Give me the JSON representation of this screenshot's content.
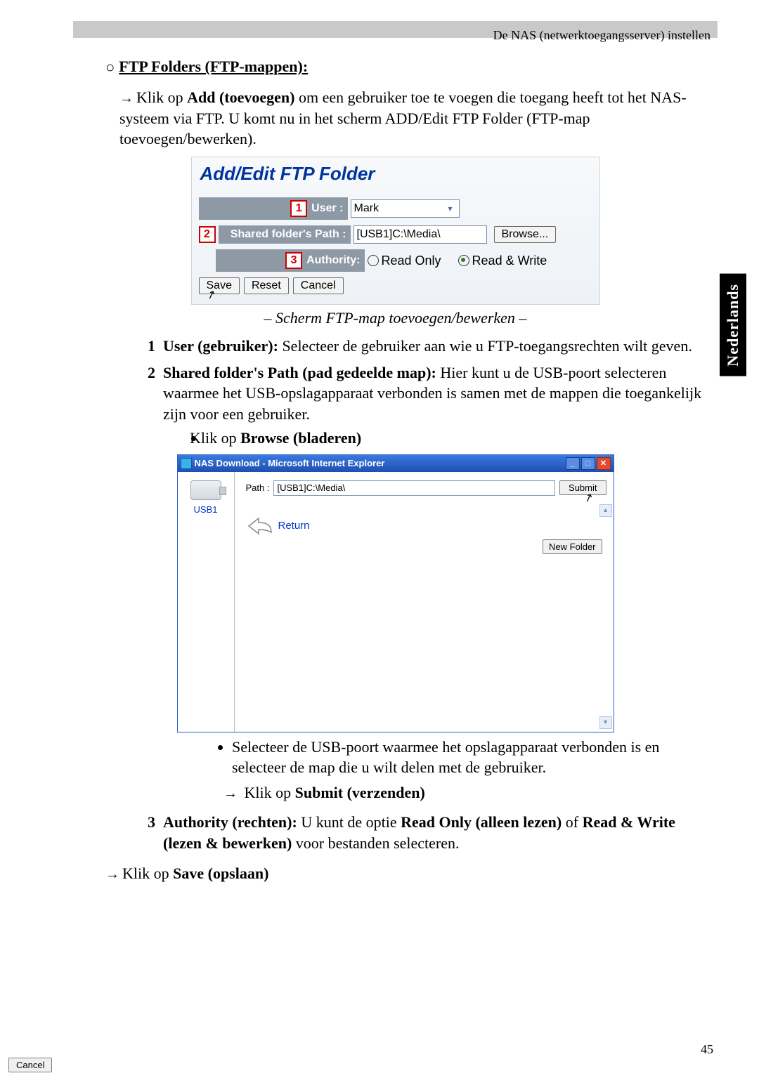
{
  "header": {
    "title": "De NAS (netwerktoegangsserver) instellen"
  },
  "sideTab": "Nederlands",
  "sectionTitle": "FTP Folders (FTP-mappen):",
  "intro": {
    "prefix": "Klik op ",
    "addBold": "Add (toevoegen)",
    "rest": " om een gebruiker toe te voegen die toegang heeft tot het NAS-systeem via FTP. U komt nu in het scherm ADD/Edit FTP Folder (FTP-map toevoegen/bewerken)."
  },
  "ftpDialog": {
    "title": "Add/Edit FTP Folder",
    "markers": {
      "one": "1",
      "two": "2",
      "three": "3"
    },
    "labels": {
      "user": "User :",
      "path": "Shared folder's Path :",
      "authority": "Authority:"
    },
    "values": {
      "user": "Mark",
      "path": "[USB1]C:\\Media\\"
    },
    "buttons": {
      "browse": "Browse...",
      "save": "Save",
      "reset": "Reset",
      "cancel": "Cancel"
    },
    "authority": {
      "readOnly": "Read Only",
      "readWrite": "Read & Write",
      "selected": "readWrite"
    }
  },
  "caption": "– Scherm FTP-map toevoegen/bewerken –",
  "item1": {
    "num": "1",
    "labelBold": "User (gebruiker):",
    "text": " Selecteer de gebruiker aan wie u FTP-toegangsrechten wilt geven."
  },
  "item2": {
    "num": "2",
    "labelBold": "Shared folder's Path (pad gedeelde map):",
    "text": " Hier kunt u de USB-poort selecteren waarmee het USB-opslagapparaat verbonden is samen met de mappen die toegankelijk zijn voor een gebruiker.",
    "sub": {
      "prefix": "Klik op ",
      "bold": "Browse (bladeren)"
    }
  },
  "ieWindow": {
    "title": "NAS Download - Microsoft Internet Explorer",
    "pathLabel": "Path :",
    "pathValue": "[USB1]C:\\Media\\",
    "submit": "Submit",
    "usbLabel": "USB1",
    "return": "Return",
    "newFolder": "New Folder",
    "cancel": "Cancel"
  },
  "afterIE": {
    "bullet1": "Selecteer de USB-poort waarmee het opslagapparaat verbonden is en selecteer de map die u wilt delen met de gebruiker.",
    "arrowPrefix": "Klik op ",
    "arrowBold": "Submit (verzenden)"
  },
  "item3": {
    "num": "3",
    "labelBold": "Authority (rechten):",
    "text1": " U kunt de optie ",
    "bold1": "Read Only (alleen lezen)",
    "mid": " of ",
    "bold2": "Read & Write (lezen & bewerken)",
    "text2": " voor bestanden selecteren."
  },
  "finalArrow": {
    "prefix": "Klik op ",
    "bold": "Save (opslaan)"
  },
  "pageNumber": "45"
}
